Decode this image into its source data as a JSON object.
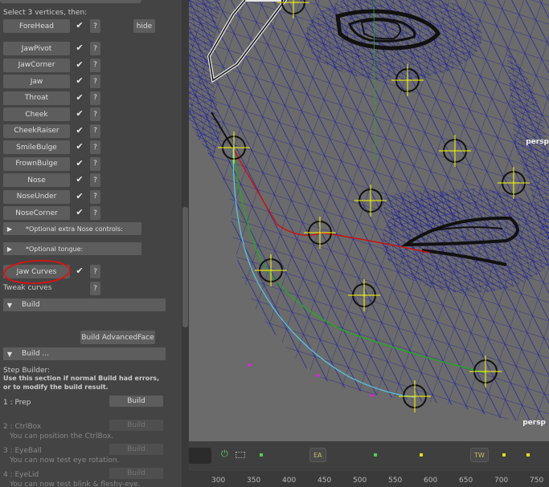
{
  "panel": {
    "select_text": "Select 3 vertices, then:",
    "forehead": {
      "label": "ForeHead",
      "help": "?",
      "hide": "hide"
    },
    "check_glyph": "✔",
    "rows": [
      {
        "label": "JawPivot",
        "help": "?"
      },
      {
        "label": "JawCorner",
        "help": "?"
      },
      {
        "label": "Jaw",
        "help": "?"
      },
      {
        "label": "Throat",
        "help": "?"
      },
      {
        "label": "Cheek",
        "help": "?"
      },
      {
        "label": "CheekRaiser",
        "help": "?"
      },
      {
        "label": "SmileBulge",
        "help": "?"
      },
      {
        "label": "FrownBulge",
        "help": "?"
      },
      {
        "label": "Nose",
        "help": "?"
      },
      {
        "label": "NoseUnder",
        "help": "?"
      },
      {
        "label": "NoseCorner",
        "help": "?"
      }
    ],
    "optional_nose": "*Optional extra Nose controls:",
    "optional_tongue": "*Optional tongue:",
    "jaw_curves": {
      "label": "Jaw Curves",
      "help": "?"
    },
    "tweak_curves": {
      "label": "Tweak curves",
      "help": "?"
    },
    "build_section": "Build",
    "build_advanced": "Build AdvancedFace",
    "build_dots_section": "Build ...",
    "step_builder": "Step Builder:",
    "step_note1": "Use this section if normal Build had errors,",
    "step_note2": "or to modify the build result.",
    "steps": [
      {
        "label": "1 : Prep",
        "button": "Build",
        "note": ""
      },
      {
        "label": "2 : CtrlBox",
        "button": "Build",
        "note": "You can position the CtrlBox."
      },
      {
        "label": "3 : EyeBall",
        "button": "Build",
        "note": "You can now test eye rotation."
      },
      {
        "label": "4 : EyeLid",
        "button": "Build",
        "note": "You can now test blink & fleshy-eye."
      }
    ]
  },
  "viewport": {
    "camera_label": "persp",
    "camera_label_partial": "persp"
  },
  "timeline": {
    "tag_ea": "EA",
    "tag_tw": "TW",
    "power_icon": "⏻"
  },
  "ruler": {
    "ticks": [
      "300",
      "350",
      "400",
      "450",
      "500",
      "550",
      "600",
      "650",
      "700",
      "750"
    ]
  },
  "colors": {
    "jaw_curve_highlight": "#cc1111",
    "wire": "#1a1a9a",
    "marker": "#ffff00"
  }
}
